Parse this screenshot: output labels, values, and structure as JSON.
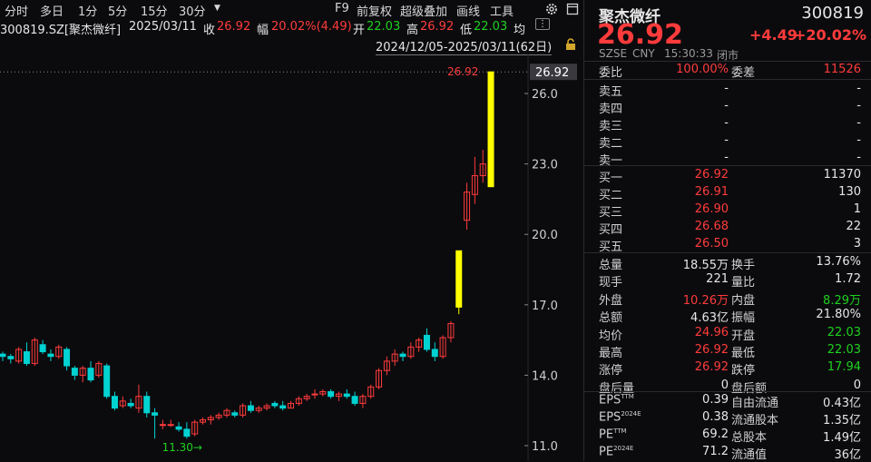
{
  "toolbar": {
    "items": [
      "分时",
      "多日",
      "1分",
      "5分",
      "15分",
      "30分"
    ],
    "dropdown_icon": "caret-down-icon",
    "right_items": [
      "F9",
      "前复权",
      "超级叠加",
      "画线",
      "工具"
    ]
  },
  "info": {
    "symbol": "300819.SZ[聚杰微纤]",
    "date": "2025/03/11",
    "close_label": "收",
    "close": "26.92",
    "change_label": "幅",
    "change": "20.02%(4.49)",
    "open_label": "开",
    "open": "22.03",
    "high_label": "高",
    "high": "26.92",
    "low_label": "低",
    "low": "22.03",
    "avg_label": "均",
    "range": "2024/12/05-2025/03/11(62日)"
  },
  "chart_data": {
    "type": "candlestick",
    "y_ticks": [
      "26.0",
      "23.0",
      "20.0",
      "17.0",
      "14.0",
      "11.0"
    ],
    "last_price_tag": "26.92",
    "max_label": "26.92",
    "min_label": "11.30→",
    "candles": [
      [
        14.9,
        15.0,
        14.6,
        14.8
      ],
      [
        14.8,
        14.9,
        14.5,
        14.7
      ],
      [
        14.6,
        15.2,
        14.5,
        15.1
      ],
      [
        15.0,
        15.4,
        14.4,
        14.5
      ],
      [
        14.5,
        15.6,
        14.4,
        15.5
      ],
      [
        15.3,
        15.5,
        14.9,
        15.0
      ],
      [
        14.9,
        15.1,
        14.6,
        14.8
      ],
      [
        14.8,
        15.3,
        14.7,
        15.2
      ],
      [
        15.1,
        15.2,
        14.2,
        14.4
      ],
      [
        14.3,
        14.4,
        13.8,
        14.0
      ],
      [
        14.0,
        14.4,
        13.7,
        14.3
      ],
      [
        14.3,
        14.6,
        13.7,
        13.8
      ],
      [
        14.0,
        14.6,
        13.9,
        14.5
      ],
      [
        14.4,
        14.5,
        13.0,
        13.1
      ],
      [
        13.1,
        13.3,
        12.5,
        12.6
      ],
      [
        12.7,
        13.1,
        12.6,
        12.9
      ],
      [
        12.8,
        13.0,
        12.6,
        12.7
      ],
      [
        12.6,
        13.6,
        12.4,
        13.1
      ],
      [
        13.1,
        13.3,
        12.2,
        12.4
      ],
      [
        12.4,
        12.6,
        11.3,
        12.3
      ],
      [
        11.9,
        12.1,
        11.7,
        11.9
      ],
      [
        11.9,
        12.1,
        11.8,
        11.9
      ],
      [
        11.8,
        12.0,
        11.6,
        11.7
      ],
      [
        11.7,
        12.0,
        11.3,
        11.4
      ],
      [
        11.5,
        12.1,
        11.4,
        12.0
      ],
      [
        12.0,
        12.2,
        11.9,
        12.1
      ],
      [
        12.1,
        12.3,
        11.9,
        12.2
      ],
      [
        12.2,
        12.4,
        12.1,
        12.3
      ],
      [
        12.3,
        12.6,
        12.2,
        12.5
      ],
      [
        12.4,
        12.5,
        12.2,
        12.3
      ],
      [
        12.3,
        12.8,
        12.2,
        12.7
      ],
      [
        12.7,
        12.9,
        12.4,
        12.5
      ],
      [
        12.5,
        12.7,
        12.4,
        12.6
      ],
      [
        12.6,
        12.8,
        12.5,
        12.7
      ],
      [
        12.8,
        12.9,
        12.6,
        12.7
      ],
      [
        12.7,
        12.9,
        12.5,
        12.6
      ],
      [
        12.6,
        12.9,
        12.6,
        12.8
      ],
      [
        12.8,
        13.1,
        12.7,
        13.0
      ],
      [
        13.0,
        13.2,
        12.9,
        13.1
      ],
      [
        13.2,
        13.4,
        13.0,
        13.2
      ],
      [
        13.2,
        13.4,
        13.1,
        13.3
      ],
      [
        13.3,
        13.4,
        13.0,
        13.1
      ],
      [
        13.1,
        13.3,
        12.9,
        13.2
      ],
      [
        13.2,
        13.4,
        13.0,
        13.1
      ],
      [
        13.1,
        13.3,
        12.7,
        12.8
      ],
      [
        12.8,
        13.2,
        12.6,
        13.1
      ],
      [
        13.1,
        13.6,
        13.0,
        13.5
      ],
      [
        13.5,
        14.3,
        13.4,
        14.2
      ],
      [
        14.2,
        14.8,
        14.0,
        14.6
      ],
      [
        14.6,
        15.1,
        14.4,
        14.9
      ],
      [
        14.9,
        15.0,
        14.6,
        14.8
      ],
      [
        14.8,
        15.4,
        14.7,
        15.2
      ],
      [
        15.2,
        15.6,
        15.0,
        15.5
      ],
      [
        15.7,
        16.0,
        15.0,
        15.1
      ],
      [
        15.1,
        15.4,
        14.6,
        14.8
      ],
      [
        14.8,
        15.7,
        14.7,
        15.6
      ],
      [
        15.6,
        16.3,
        15.4,
        16.2
      ],
      [
        16.9,
        19.3,
        16.6,
        19.3
      ],
      [
        20.6,
        22.2,
        20.2,
        21.8
      ],
      [
        21.7,
        23.3,
        21.3,
        22.5
      ],
      [
        22.5,
        23.6,
        22.2,
        23.0
      ],
      [
        22.03,
        26.92,
        22.03,
        26.92
      ]
    ],
    "colors": {
      "up": "#ff3b3b",
      "down": "#00d2d2",
      "limit_up": "#ffff00"
    }
  },
  "quote": {
    "name": "聚杰微纤",
    "code": "300819",
    "price": "26.92",
    "change": "+4.49",
    "pct": "+20.02%",
    "exchange": "SZSE",
    "currency": "CNY",
    "time": "15:30:33",
    "status": "闭市"
  },
  "book_ratio": {
    "l1": "委比",
    "v1": "100.00%",
    "l2": "委差",
    "v2": "11526"
  },
  "asks": [
    {
      "label": "卖五",
      "price": "-",
      "vol": "-"
    },
    {
      "label": "卖四",
      "price": "-",
      "vol": "-"
    },
    {
      "label": "卖三",
      "price": "-",
      "vol": "-"
    },
    {
      "label": "卖二",
      "price": "-",
      "vol": "-"
    },
    {
      "label": "卖一",
      "price": "-",
      "vol": "-"
    }
  ],
  "bids": [
    {
      "label": "买一",
      "price": "26.92",
      "vol": "11370"
    },
    {
      "label": "买二",
      "price": "26.91",
      "vol": "130"
    },
    {
      "label": "买三",
      "price": "26.90",
      "vol": "1"
    },
    {
      "label": "买四",
      "price": "26.68",
      "vol": "22"
    },
    {
      "label": "买五",
      "price": "26.50",
      "vol": "3"
    }
  ],
  "stats": [
    {
      "l1": "总量",
      "v1": "18.55万",
      "c1": "white",
      "l2": "换手",
      "v2": "13.76%",
      "c2": "white"
    },
    {
      "l1": "现手",
      "v1": "221",
      "c1": "white",
      "l2": "量比",
      "v2": "1.72",
      "c2": "white"
    },
    {
      "l1": "外盘",
      "v1": "10.26万",
      "c1": "red",
      "l2": "内盘",
      "v2": "8.29万",
      "c2": "green"
    },
    {
      "l1": "总额",
      "v1": "4.63亿",
      "c1": "white",
      "l2": "振幅",
      "v2": "21.80%",
      "c2": "white"
    },
    {
      "l1": "均价",
      "v1": "24.96",
      "c1": "red",
      "l2": "开盘",
      "v2": "22.03",
      "c2": "green"
    },
    {
      "l1": "最高",
      "v1": "26.92",
      "c1": "red",
      "l2": "最低",
      "v2": "22.03",
      "c2": "green"
    },
    {
      "l1": "涨停",
      "v1": "26.92",
      "c1": "red",
      "l2": "跌停",
      "v2": "17.94",
      "c2": "green"
    },
    {
      "l1": "盘后量",
      "v1": "0",
      "c1": "white",
      "l2": "盘后额",
      "v2": "0",
      "c2": "white"
    }
  ],
  "fundamentals": [
    {
      "l1": "EPS",
      "s1": "TTM",
      "v1": "0.39",
      "l2": "自由流通",
      "v2": "0.43亿"
    },
    {
      "l1": "EPS",
      "s1": "2024E",
      "v1": "0.38",
      "l2": "流通股本",
      "v2": "1.35亿"
    },
    {
      "l1": "PE",
      "s1": "TTM",
      "v1": "69.2",
      "l2": "总股本",
      "v2": "1.49亿"
    },
    {
      "l1": "PE",
      "s1": "2024E",
      "v1": "71.2",
      "l2": "流通值",
      "v2": "36亿"
    }
  ],
  "icons": {
    "settings": "gear-icon",
    "window": "window-icon",
    "lock": "lock-icon"
  }
}
